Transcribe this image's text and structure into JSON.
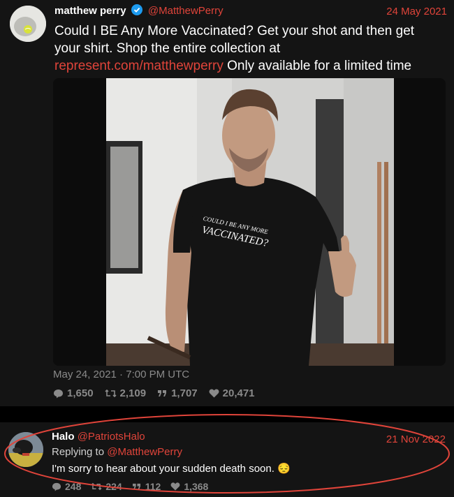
{
  "tweet": {
    "display_name": "matthew perry",
    "handle": "@MatthewPerry",
    "date": "24 May 2021",
    "text_line1": "Could I BE Any More Vaccinated? Get your shot and then get",
    "text_line2": "your shirt. Shop the entire collection at",
    "link": "represent.com/matthewperry",
    "text_tail": " Only available for a limited time",
    "timestamp": "May 24, 2021 · 7:00 PM UTC",
    "shirt_text_1": "COULD I BE ANY MORE",
    "shirt_text_2": "VACCINATED?",
    "stats": {
      "replies": "1,650",
      "retweets": "2,109",
      "quotes": "1,707",
      "likes": "20,471"
    }
  },
  "reply": {
    "display_name": "Halo",
    "handle": "@PatriotsHalo",
    "date": "21 Nov 2022",
    "replying_prefix": "Replying to ",
    "replying_to": "@MatthewPerry",
    "text": "I'm sorry to hear about your sudden death soon. 😔",
    "stats": {
      "replies": "248",
      "retweets": "224",
      "quotes": "112",
      "likes": "1,368"
    }
  },
  "colors": {
    "accent": "#e0443a",
    "verified": "#1d9bf0",
    "background": "#141414",
    "muted": "#8a8a8a"
  },
  "icons": [
    "verified-icon",
    "reply-icon",
    "retweet-icon",
    "quote-icon",
    "heart-icon",
    "pensive-emoji"
  ]
}
